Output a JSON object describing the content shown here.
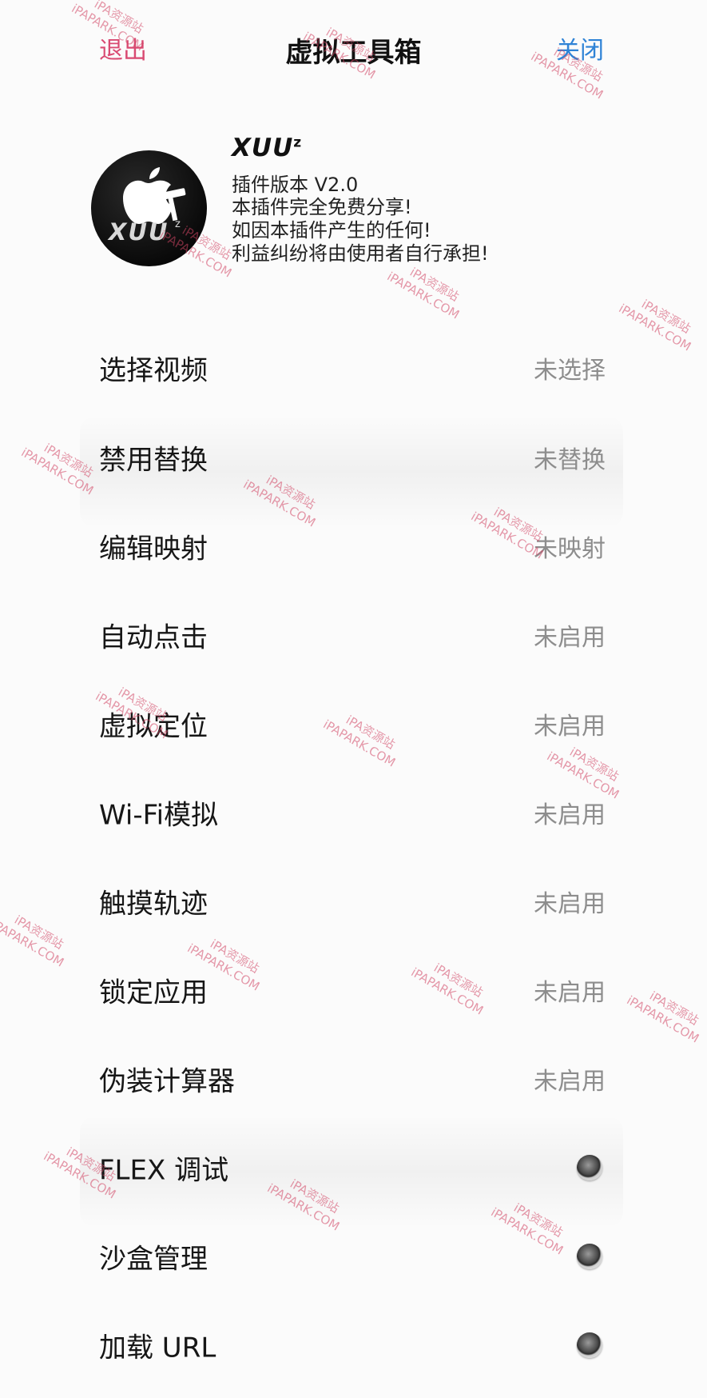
{
  "nav": {
    "exit_label": "退出",
    "title": "虚拟工具箱",
    "close_label": "关闭"
  },
  "header": {
    "brand": "XUU",
    "brand_sup": "z",
    "logo_text": "XUU",
    "logo_sup": "z",
    "lines": [
      "插件版本 V2.0",
      "本插件完全免费分享!",
      "如因本插件产生的任何!",
      "利益纠纷将由使用者自行承担!"
    ]
  },
  "menu": [
    {
      "label": "选择视频",
      "value": "未选择"
    },
    {
      "label": "禁用替换",
      "value": "未替换"
    },
    {
      "label": "编辑映射",
      "value": "未映射"
    },
    {
      "label": "自动点击",
      "value": "未启用"
    },
    {
      "label": "虚拟定位",
      "value": "未启用"
    },
    {
      "label": "Wi-Fi模拟",
      "value": "未启用"
    },
    {
      "label": "触摸轨迹",
      "value": "未启用"
    },
    {
      "label": "锁定应用",
      "value": "未启用"
    },
    {
      "label": "伪装计算器",
      "value": "未启用"
    },
    {
      "label": "FLEX 调试",
      "toggle": "radio"
    },
    {
      "label": "沙盒管理",
      "toggle": "radio"
    },
    {
      "label": "加载 URL",
      "toggle": "radio"
    }
  ],
  "watermark": {
    "line1": "iPA资源站",
    "line2": "iPAPARK.COM"
  },
  "colors": {
    "exit": "#d94a72",
    "close": "#2f83d6",
    "value_text": "#8d8d8d",
    "watermark": "#d24664"
  }
}
